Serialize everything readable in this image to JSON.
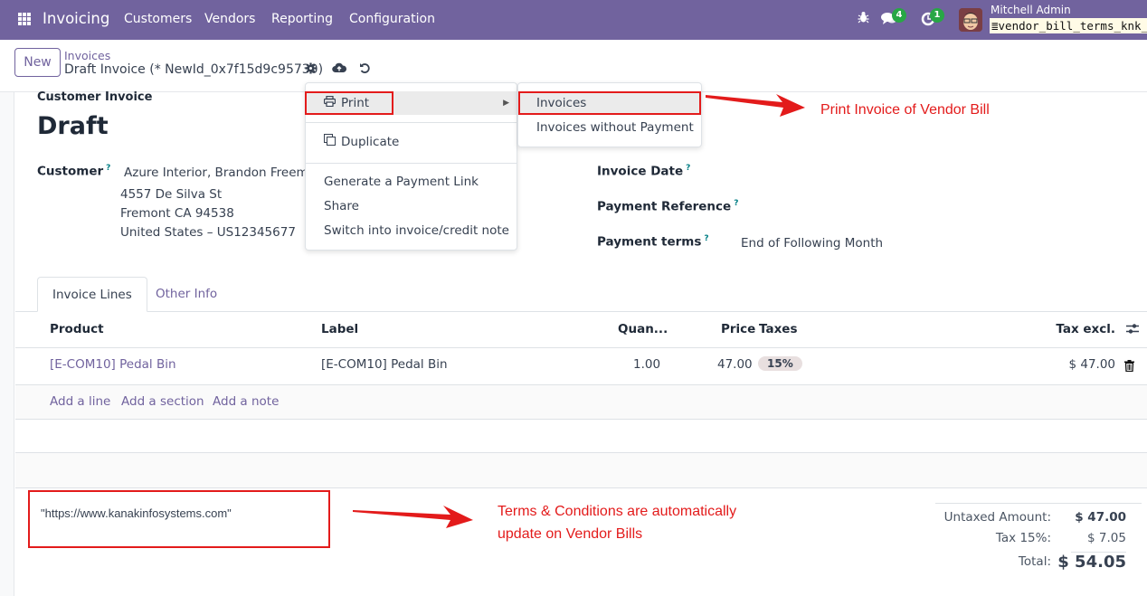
{
  "navbar": {
    "app_name": "Invoicing",
    "menu": [
      "Customers",
      "Vendors",
      "Reporting",
      "Configuration"
    ],
    "messages_count": "4",
    "activities_count": "1",
    "user_name": "Mitchell Admin",
    "database": "vendor_bill_terms_knk_"
  },
  "control_panel": {
    "new_label": "New",
    "breadcrumb_parent": "Invoices",
    "breadcrumb_current": "Draft Invoice (* NewId_0x7f15d9c95730)"
  },
  "form": {
    "move_type": "Customer Invoice",
    "state_title": "Draft",
    "customer_label": "Customer",
    "customer_name": "Azure Interior, Brandon Freeman",
    "address": [
      "4557 De Silva St",
      "Fremont CA 94538",
      "United States – US12345677"
    ],
    "invoice_date_label": "Invoice Date",
    "payment_reference_label": "Payment Reference",
    "payment_terms_label": "Payment terms",
    "payment_terms_value": "End of Following Month",
    "help_mark": "?"
  },
  "tabs": [
    {
      "label": "Invoice Lines",
      "active": true
    },
    {
      "label": "Other Info",
      "active": false
    }
  ],
  "lines_table": {
    "headers": {
      "product": "Product",
      "label": "Label",
      "quantity": "Quan...",
      "price": "Price",
      "taxes": "Taxes",
      "tax_excl": "Tax excl."
    },
    "rows": [
      {
        "product": "[E-COM10] Pedal Bin",
        "label": "[E-COM10] Pedal Bin",
        "quantity": "1.00",
        "price": "47.00",
        "taxes": "15%",
        "tax_excl": "$ 47.00"
      }
    ],
    "add_line": "Add a line",
    "add_section": "Add a section",
    "add_note": "Add a note"
  },
  "terms": {
    "text": "\"https://www.kanakinfosystems.com\""
  },
  "totals": {
    "untaxed_label": "Untaxed Amount:",
    "untaxed_value": "$ 47.00",
    "tax_label": "Tax 15%:",
    "tax_value": "$ 7.05",
    "total_label": "Total:",
    "total_value": "$ 54.05"
  },
  "action_menu": {
    "print": "Print",
    "duplicate": "Duplicate",
    "generate_payment_link": "Generate a Payment Link",
    "share": "Share",
    "switch": "Switch into invoice/credit note",
    "print_submenu": [
      "Invoices",
      "Invoices without Payment"
    ]
  },
  "annotations": {
    "print_note": "Print Invoice of Vendor Bill",
    "terms_note_line1": "Terms & Conditions are automatically",
    "terms_note_line2": "update on Vendor Bills",
    "color": "#e31b1b"
  }
}
